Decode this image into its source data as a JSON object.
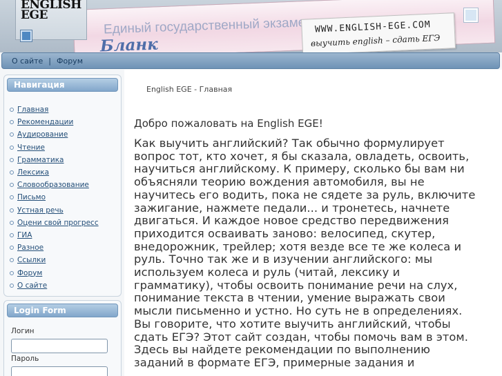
{
  "header": {
    "logo_text": "ENGLISH EGE",
    "form_line": "Единый государственный экзамен -",
    "form_big": "Бланк",
    "url": "WWW.ENGLISH-EGE.COM",
    "slogan": "выучить english – сдать ЕГЭ"
  },
  "topnav": {
    "items": [
      {
        "label": "О сайте"
      },
      {
        "label": "Форум"
      }
    ],
    "separator": "|"
  },
  "sidebar": {
    "nav_title": "Навигация",
    "nav_items": [
      {
        "label": "Главная"
      },
      {
        "label": "Рекомендации"
      },
      {
        "label": "Аудирование"
      },
      {
        "label": "Чтение"
      },
      {
        "label": "Грамматика"
      },
      {
        "label": "Лексика"
      },
      {
        "label": "Словообразование"
      },
      {
        "label": "Письмо"
      },
      {
        "label": "Устная речь"
      },
      {
        "label": "Оцени свой прогресс"
      },
      {
        "label": "ГИА"
      },
      {
        "label": "Разное"
      },
      {
        "label": "Ссылки"
      },
      {
        "label": "Форум"
      },
      {
        "label": "О сайте"
      }
    ],
    "login_title": "Login Form",
    "login_label": "Логин",
    "password_label": "Пароль"
  },
  "main": {
    "breadcrumb": "English EGE - Главная",
    "welcome": "Добро пожаловать на English EGE!",
    "article": "Как выучить английский? Так обычно формулирует\nвопрос тот, кто хочет, я бы сказала, овладеть, освоить,\nнаучиться английскому. К примеру, сколько бы вам ни\nобъясняли теорию вождения автомобиля, вы не\nнаучитесь его водить, пока не сядете за руль, включите\nзажигание, нажмете педали... и тронетесь, начнете\nдвигаться. И каждое новое средство передвижения\nприходится осваивать заново: велосипед, скутер,\nвнедорожник, трейлер; хотя везде все те же колеса и\nруль. Точно так же и в изучении английского: мы\nиспользуем колеса и руль              (читай, лексику и\nграмматику), чтобы освоить понимание речи на слух,\nпонимание текста в чтении, умение выражать свои\nмысли письменно и устно.   Но суть не в определениях.\nВы говорите, что хотите выучить английский, чтобы\nсдать ЕГЭ? Этот сайт создан, чтобы помочь вам в этом.\nЗдесь вы найдете рекомендации по выполнению\nзаданий в формате ЕГЭ, примерные задания и"
  },
  "colors": {
    "accent": "#82a7cb",
    "link": "#234e78",
    "nav_bar": "#6f93b6"
  }
}
